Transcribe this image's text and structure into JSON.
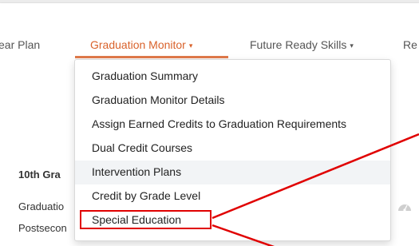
{
  "nav": {
    "items": [
      {
        "label": "ear Plan",
        "active": false,
        "dropdown": false
      },
      {
        "label": "Graduation Monitor",
        "active": true,
        "dropdown": true
      },
      {
        "label": "Future Ready Skills",
        "active": false,
        "dropdown": true
      },
      {
        "label": "Re",
        "active": false,
        "dropdown": false
      }
    ],
    "caret": "▾"
  },
  "background": {
    "section_heading": "10th Gra",
    "rows": [
      "Graduatio",
      "Postsecon"
    ]
  },
  "dropdown": {
    "items": [
      "Graduation Summary",
      "Graduation Monitor Details",
      "Assign Earned Credits to Graduation Requirements",
      "Dual Credit Courses",
      "Intervention Plans",
      "Credit by Grade Level",
      "Special Education"
    ],
    "hovered_index": 4,
    "highlighted_index": 6
  },
  "colors": {
    "accent": "#d9622b",
    "annotation": "#e00000",
    "hover": "#f2f4f6"
  },
  "icons": [
    "caret-down-icon",
    "gauge-icon"
  ]
}
